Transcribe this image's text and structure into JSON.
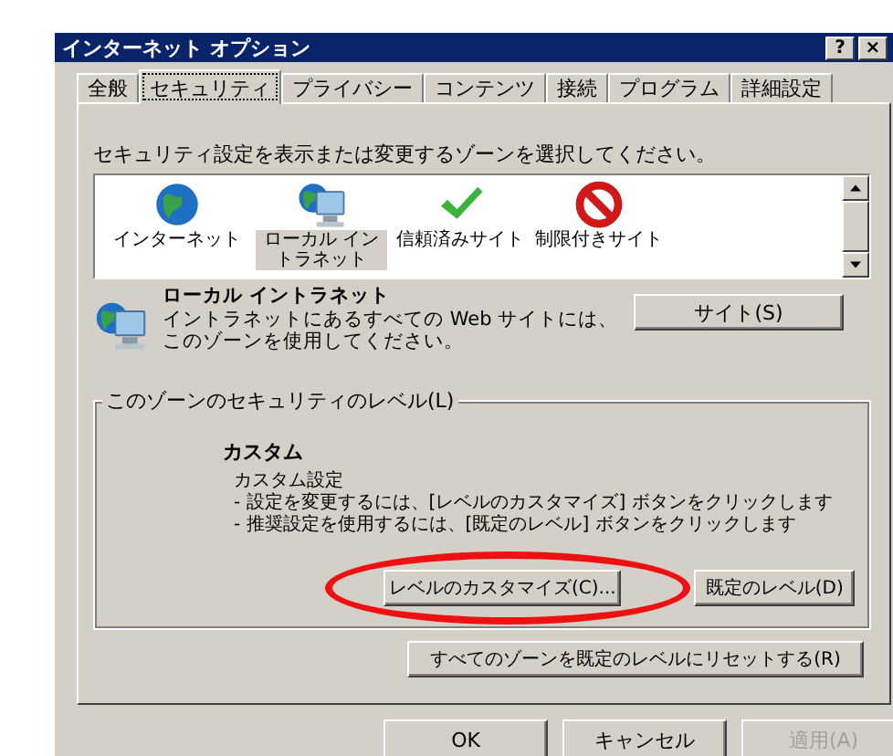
{
  "window": {
    "title": "インターネット オプション",
    "controls": [
      "?",
      "×"
    ]
  },
  "tabs": [
    {
      "label": "全般",
      "selected": false
    },
    {
      "label": "セキュリティ",
      "selected": true
    },
    {
      "label": "プライバシー",
      "selected": false
    },
    {
      "label": "コンテンツ",
      "selected": false
    },
    {
      "label": "接続",
      "selected": false
    },
    {
      "label": "プログラム",
      "selected": false
    },
    {
      "label": "詳細設定",
      "selected": false
    }
  ],
  "zone_prompt": "セキュリティ設定を表示または変更するゾーンを選択してください。",
  "zones": [
    {
      "label": "インターネット",
      "kind": "globe",
      "selected": false
    },
    {
      "label": "ローカル イントラネット",
      "kind": "intranet",
      "selected": true
    },
    {
      "label": "信頼済みサイト",
      "kind": "check",
      "selected": false
    },
    {
      "label": "制限付きサイト",
      "kind": "blocked",
      "selected": false
    }
  ],
  "zone_detail": {
    "kind": "intranet",
    "title": "ローカル イントラネット",
    "description": "イントラネットにあるすべての Web サイトには、このゾーンを使用してください。",
    "button": "サイト(S)"
  },
  "level_group": {
    "title": "このゾーンのセキュリティのレベル(L)",
    "level_name": "カスタム",
    "lines": [
      "カスタム設定",
      "- 設定を変更するには、[レベルのカスタマイズ] ボタンをクリックします",
      "- 推奨設定を使用するには、[既定のレベル] ボタンをクリックします"
    ],
    "buttons": [
      "レベルのカスタマイズ(C)...",
      "既定のレベル(D)"
    ],
    "reset_button": "すべてのゾーンを既定のレベルにリセットする(R)"
  },
  "buttons": [
    {
      "label": "OK",
      "disabled": false
    },
    {
      "label": "キャンセル",
      "disabled": false
    },
    {
      "label": "適用(A)",
      "disabled": true
    }
  ]
}
